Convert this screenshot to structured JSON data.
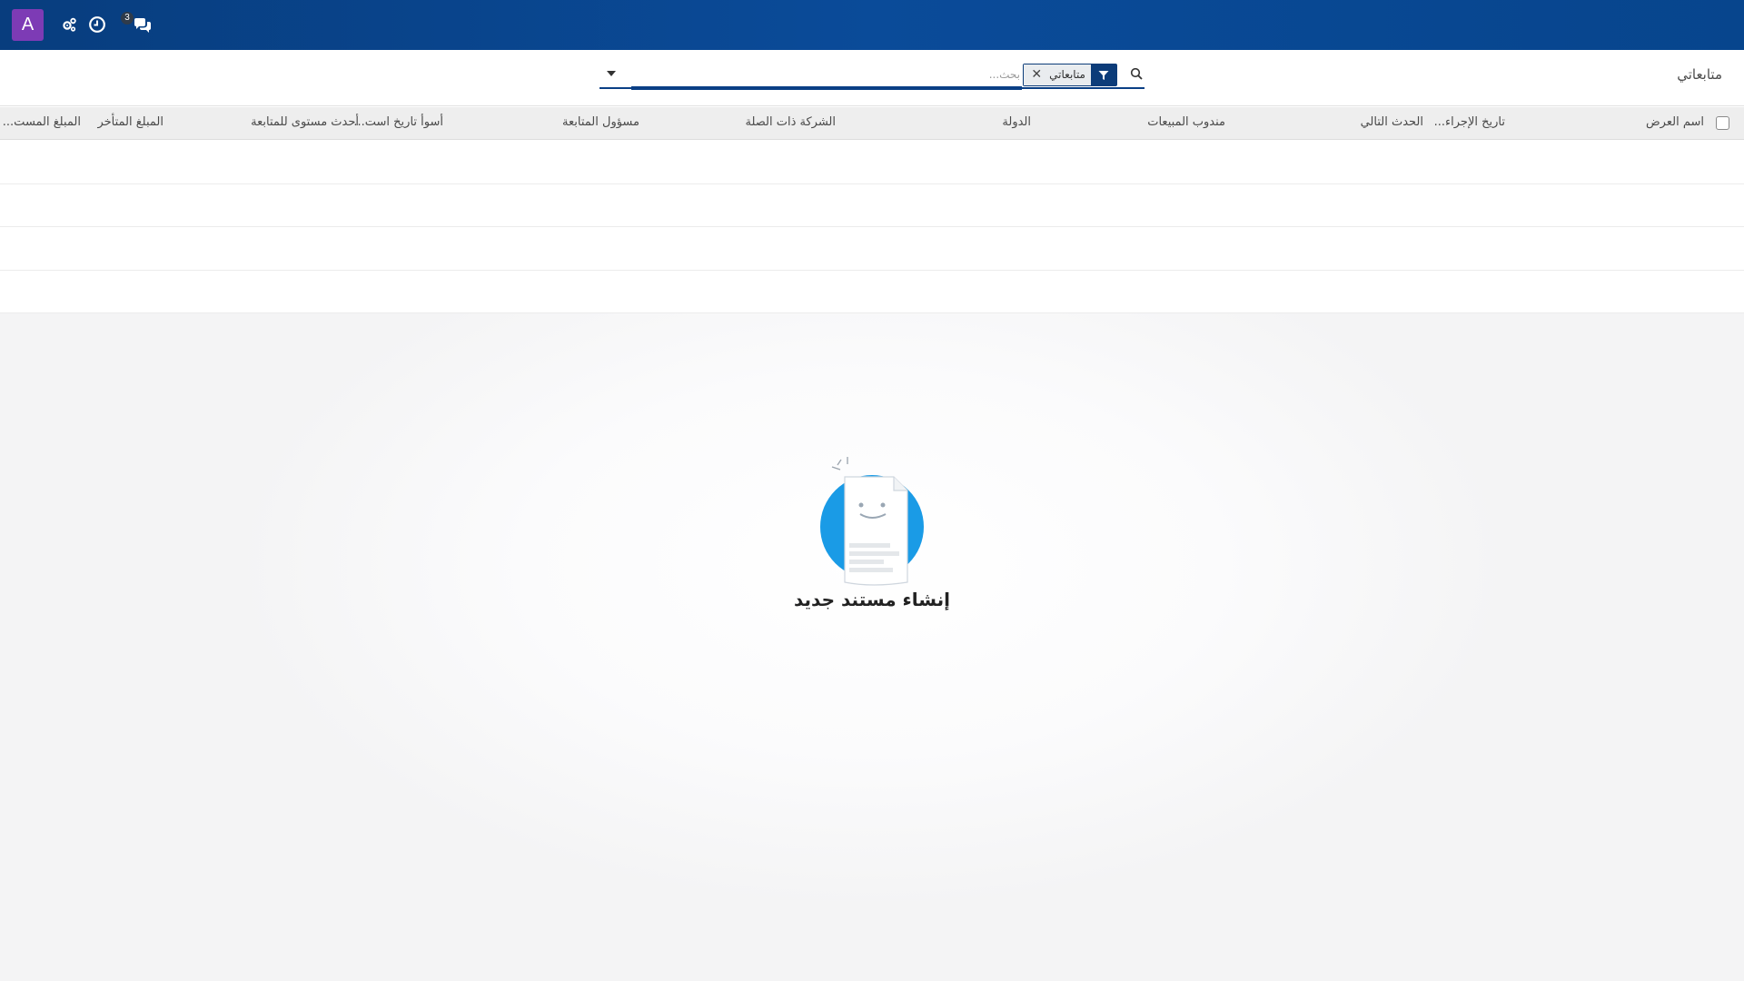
{
  "navbar": {
    "avatar_letter": "A",
    "activity_count": "3",
    "icons": [
      "settings-icon",
      "clock-icon",
      "chat-icon"
    ]
  },
  "control_panel": {
    "breadcrumb": "متابعاتي",
    "search": {
      "facet_value": "متابعاتي",
      "placeholder": "بحث..."
    }
  },
  "table": {
    "columns": [
      "اسم العرض",
      "تاريخ الإجراء...",
      "الحدث التالي",
      "مندوب المبيعات",
      "الدولة",
      "الشركة ذات الصلة",
      "مسؤول المتابعة",
      "أسوأ تاريخ است...",
      "أحدث مستوى للمتابعة",
      "المبلغ المتأخر",
      "المبلغ المست..."
    ]
  },
  "empty_state": {
    "title": "إنشاء مستند جديد"
  },
  "colors": {
    "navbar": "#0a4b99",
    "accent": "#0c3c79",
    "avatar": "#7d3bb5",
    "illustration": "#1a9be6"
  }
}
